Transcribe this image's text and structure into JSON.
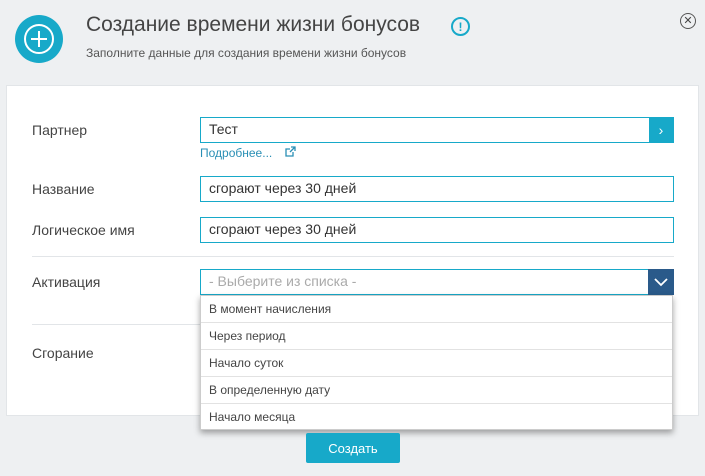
{
  "header": {
    "title": "Создание времени жизни бонусов",
    "subtitle": "Заполните данные для создания времени жизни бонусов"
  },
  "form": {
    "partner": {
      "label": "Партнер",
      "value": "Тест",
      "more_link": "Подробнее..."
    },
    "name": {
      "label": "Название",
      "value": "сгорают через 30 дней"
    },
    "logical_name": {
      "label": "Логическое имя",
      "value": "сгорают через 30 дней"
    },
    "activation": {
      "label": "Активация",
      "placeholder": "- Выберите из списка -",
      "options": [
        "В момент начисления",
        "Через период",
        "Начало суток",
        "В определенную дату",
        "Начало месяца"
      ]
    },
    "burning": {
      "label": "Сгорание"
    }
  },
  "footer": {
    "submit_label": "Создать"
  },
  "colors": {
    "accent": "#17a9c9",
    "select_button": "#2a5a8a",
    "link": "#2a8fb5"
  }
}
